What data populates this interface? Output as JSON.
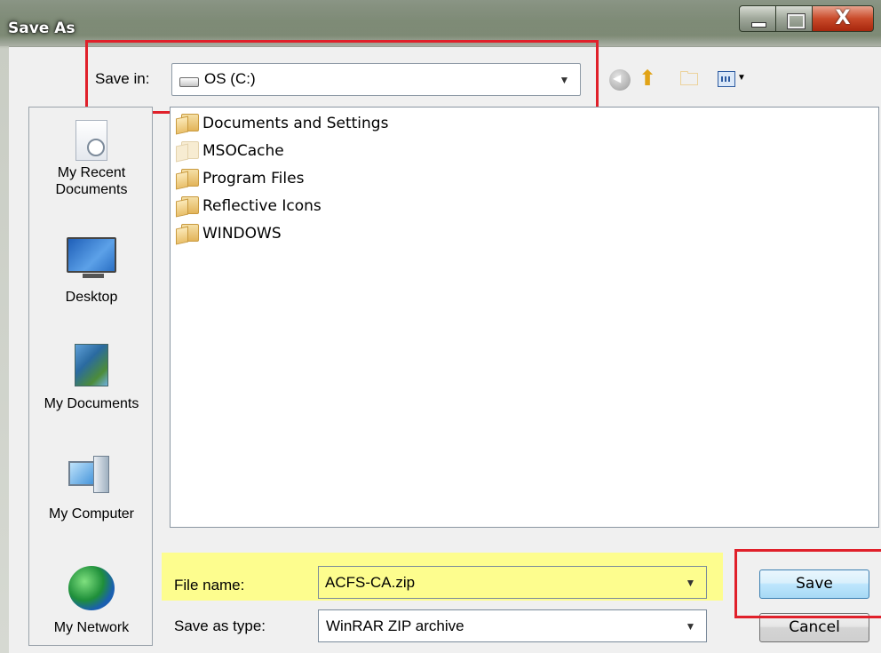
{
  "window": {
    "title": "Save As",
    "close_glyph": "X"
  },
  "toolbar": {
    "save_in_label": "Save in:",
    "save_in_value": "OS (C:)",
    "icons": [
      "back-icon",
      "up-one-level-icon",
      "new-folder-icon",
      "view-menu-icon"
    ]
  },
  "places": [
    {
      "label_line1": "My Recent",
      "label_line2": "Documents",
      "icon": "recent-documents-icon"
    },
    {
      "label_line1": "Desktop",
      "label_line2": "",
      "icon": "desktop-icon"
    },
    {
      "label_line1": "My Documents",
      "label_line2": "",
      "icon": "my-documents-icon"
    },
    {
      "label_line1": "My Computer",
      "label_line2": "",
      "icon": "my-computer-icon"
    },
    {
      "label_line1": "My Network",
      "label_line2": "",
      "icon": "my-network-icon"
    }
  ],
  "files": [
    {
      "name": "Documents and Settings",
      "icon": "folder-icon"
    },
    {
      "name": "MSOCache",
      "icon": "hidden-folder-icon"
    },
    {
      "name": "Program Files",
      "icon": "folder-icon"
    },
    {
      "name": "Reflective Icons",
      "icon": "folder-icon"
    },
    {
      "name": "WINDOWS",
      "icon": "folder-icon"
    }
  ],
  "form": {
    "file_name_label": "File name:",
    "file_name_value": "ACFS-CA.zip",
    "save_as_type_label": "Save as type:",
    "save_as_type_value": "WinRAR ZIP archive"
  },
  "buttons": {
    "save": "Save",
    "cancel": "Cancel"
  },
  "colors": {
    "highlight_red": "#e0202a",
    "highlight_yellow": "#fdfd8e",
    "save_button_blue": "#a7d9f5"
  }
}
